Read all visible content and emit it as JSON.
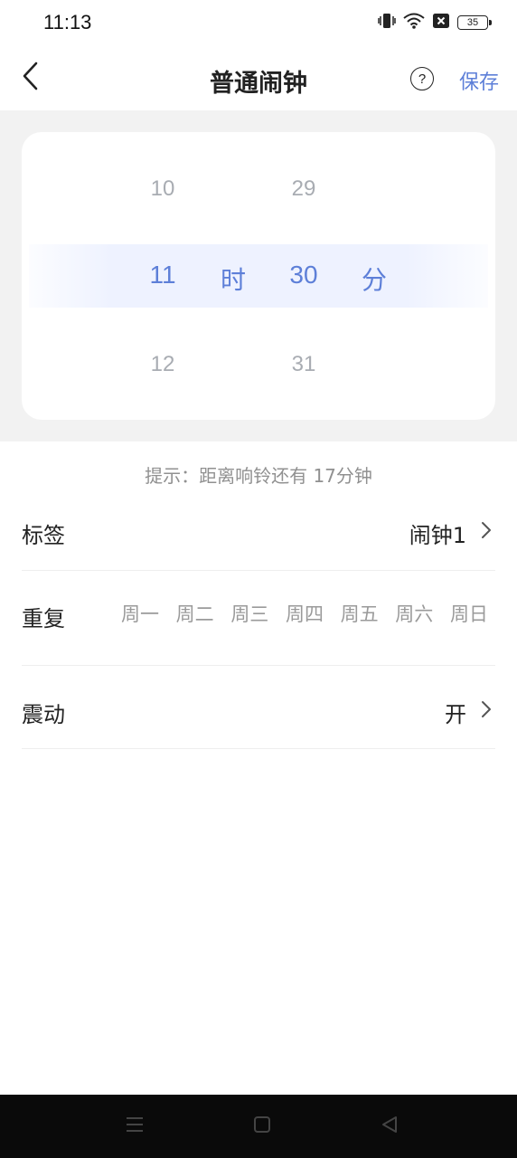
{
  "status_bar": {
    "time": "11:13",
    "battery_level": "35",
    "icons": [
      "vibrate-icon",
      "wifi-icon",
      "no-sim-icon",
      "battery-icon"
    ]
  },
  "header": {
    "title": "普通闹钟",
    "help_label": "?",
    "save_label": "保存",
    "accent_color": "#5d7fd8"
  },
  "picker": {
    "hour_above": "10",
    "hour_selected": "11",
    "hour_below": "12",
    "hour_unit": "时",
    "minute_above": "29",
    "minute_selected": "30",
    "minute_below": "31",
    "minute_unit": "分"
  },
  "hint": "提示：距离响铃还有 17分钟",
  "settings": {
    "label_row": {
      "label": "标签",
      "value": "闹钟1"
    },
    "repeat_row": {
      "label": "重复",
      "days": [
        "周一",
        "周二",
        "周三",
        "周四",
        "周五",
        "周六",
        "周日"
      ]
    },
    "vibrate_row": {
      "label": "震动",
      "value": "开"
    }
  },
  "nav_bar": {
    "buttons": [
      "menu-icon",
      "home-icon",
      "back-triangle-icon"
    ]
  }
}
